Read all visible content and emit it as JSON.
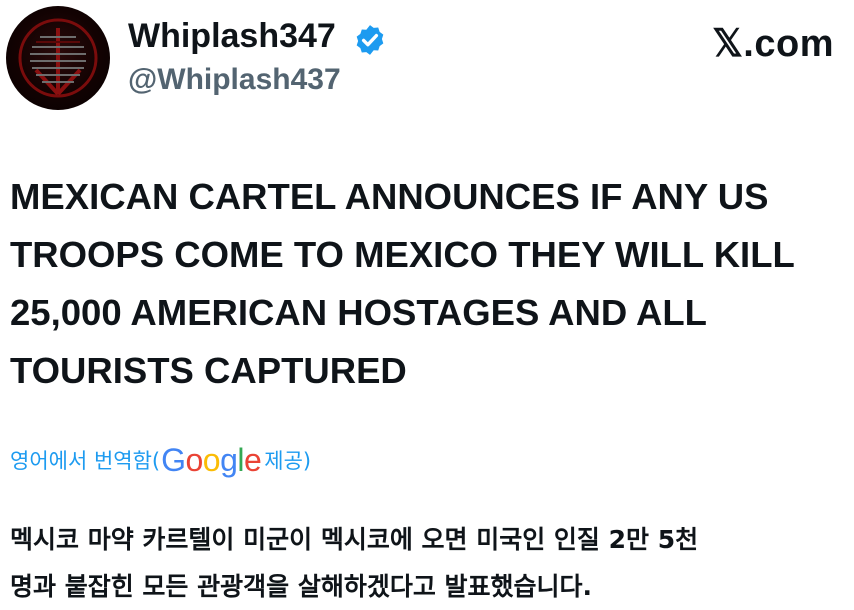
{
  "user": {
    "display_name": "Whiplash347",
    "handle": "@Whiplash437",
    "verified": true,
    "avatar_icon": "red-inverted-cross-on-black"
  },
  "source": {
    "label": "𝕏.com"
  },
  "tweet": {
    "text": "MEXICAN CARTEL ANNOUNCES IF ANY US\nTROOPS COME TO MEXICO THEY WILL KILL\n25,000 AMERICAN HOSTAGES AND ALL\nTOURISTS CAPTURED"
  },
  "translation": {
    "label_prefix": "영어에서 번역함(",
    "provider_letters": [
      "G",
      "o",
      "o",
      "g",
      "l",
      "e"
    ],
    "provider_colors": [
      "#4285F4",
      "#EA4335",
      "#FBBC05",
      "#4285F4",
      "#34A853",
      "#EA4335"
    ],
    "label_suffix": " 제공)",
    "text": "멕시코 마약 카르텔이 미군이 멕시코에 오면 미국인 인질 2만 5천\n명과 붙잡힌 모든 관광객을 살해하겠다고 발표했습니다."
  },
  "colors": {
    "verified_badge": "#1d9bf0",
    "handle": "#536471",
    "translate_link": "#1d9bf0",
    "text": "#0f1419"
  }
}
